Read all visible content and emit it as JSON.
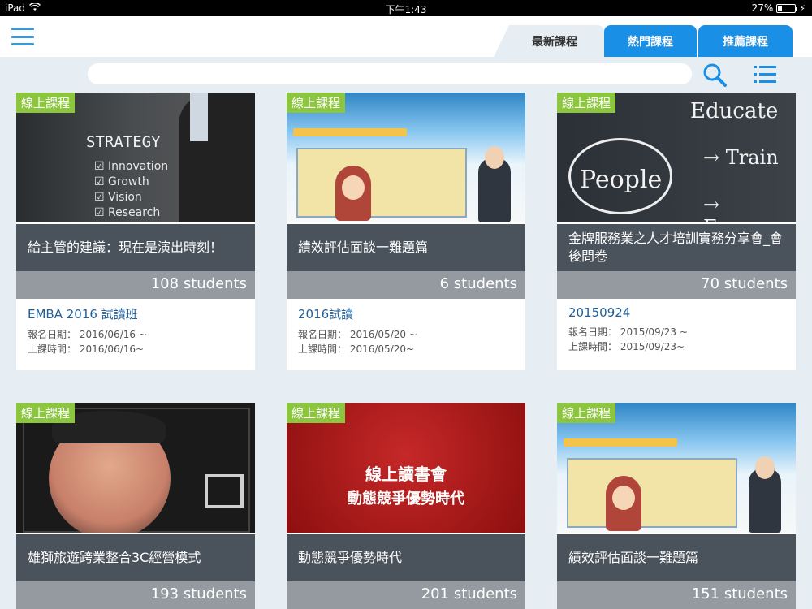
{
  "statusbar": {
    "device": "iPad",
    "time": "下午1:43",
    "battery": "27%",
    "battery_level": 0.27
  },
  "header": {
    "menu_icon": "hamburger-icon",
    "tabs": [
      {
        "label": "最新課程",
        "active": true
      },
      {
        "label": "熱門課程",
        "active": false
      },
      {
        "label": "推薦課程",
        "active": false
      }
    ]
  },
  "search": {
    "placeholder": "",
    "search_icon": "search-icon",
    "list_icon": "list-icon"
  },
  "colors": {
    "accent": "#1a8fe6",
    "tag": "#8cc63f",
    "title_band": "#4a525b",
    "students_band": "#949aa0",
    "link": "#1f5f9a"
  },
  "cards": [
    {
      "tag": "線上課程",
      "title": "給主管的建議：現在是演出時刻！",
      "students": "108 students",
      "name": "EMBA 2016 試讀班",
      "reg_label": "報名日期：",
      "reg_value": "2016/06/16 ~",
      "class_label": "上課時間：",
      "class_value": "2016/06/16~",
      "thumb": {
        "strategy": "STRATEGY",
        "items": [
          "Innovation",
          "Growth",
          "Vision",
          "Research"
        ]
      }
    },
    {
      "tag": "線上課程",
      "title": "績效評估面談一難題篇",
      "students": "6 students",
      "name": "2016試讀",
      "reg_label": "報名日期：",
      "reg_value": "2016/05/20 ~",
      "class_label": "上課時間：",
      "class_value": "2016/05/20~"
    },
    {
      "tag": "線上課程",
      "title": "金牌服務業之人才培訓實務分享會_會後問卷",
      "students": "70 students",
      "name": "20150924",
      "reg_label": "報名日期：",
      "reg_value": "2015/09/23 ~",
      "class_label": "上課時間：",
      "class_value": "2015/09/23~",
      "thumb": {
        "people": "People",
        "educate": "Educate",
        "train": "→ Train",
        "empower": "→ Empowe"
      }
    },
    {
      "tag": "線上課程",
      "title": "雄獅旅遊跨業整合3C經營模式",
      "students": "193 students"
    },
    {
      "tag": "線上課程",
      "title": "動態競爭優勢時代",
      "students": "201 students",
      "thumb": {
        "line1": "線上讀書會",
        "line2": "動態競爭優勢時代"
      }
    },
    {
      "tag": "線上課程",
      "title": "績效評估面談一難題篇",
      "students": "151 students"
    }
  ]
}
